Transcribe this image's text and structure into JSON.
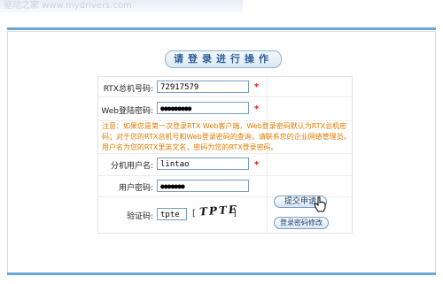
{
  "header": {
    "watermark_text": "驱动之家 www.mydrivers.com"
  },
  "title": "请登录进行操作",
  "form": {
    "rtx_number": {
      "label": "RTX总机号码:",
      "value": "72917579"
    },
    "web_password": {
      "label": "Web登陆密码:",
      "value": "●●●●●●●●●"
    },
    "notice": "注意：如果您是第一次登录RTX Web客户端，Web登录密码默认为RTX总机密码；对于您的RTX总机号和Web登录密码的查询，请联系您的企业网络管理员。用户名为您的RTX里英文名，密码为您的RTX登录密码。",
    "ext_username": {
      "label": "分机用户名:",
      "value": "lintao"
    },
    "user_password": {
      "label": "用户密码:",
      "value": "●●●●●●●"
    },
    "captcha": {
      "label": "验证码:",
      "value": "tpte",
      "image_text": "TPTE",
      "bracket_open": "[",
      "bracket_close": "]"
    },
    "required_mark": "*"
  },
  "buttons": {
    "submit": "提交申请",
    "change_password": "登录密码修改"
  },
  "colors": {
    "accent": "#6aa7d8",
    "required": "#e01e1e",
    "notice": "#e07b00"
  }
}
